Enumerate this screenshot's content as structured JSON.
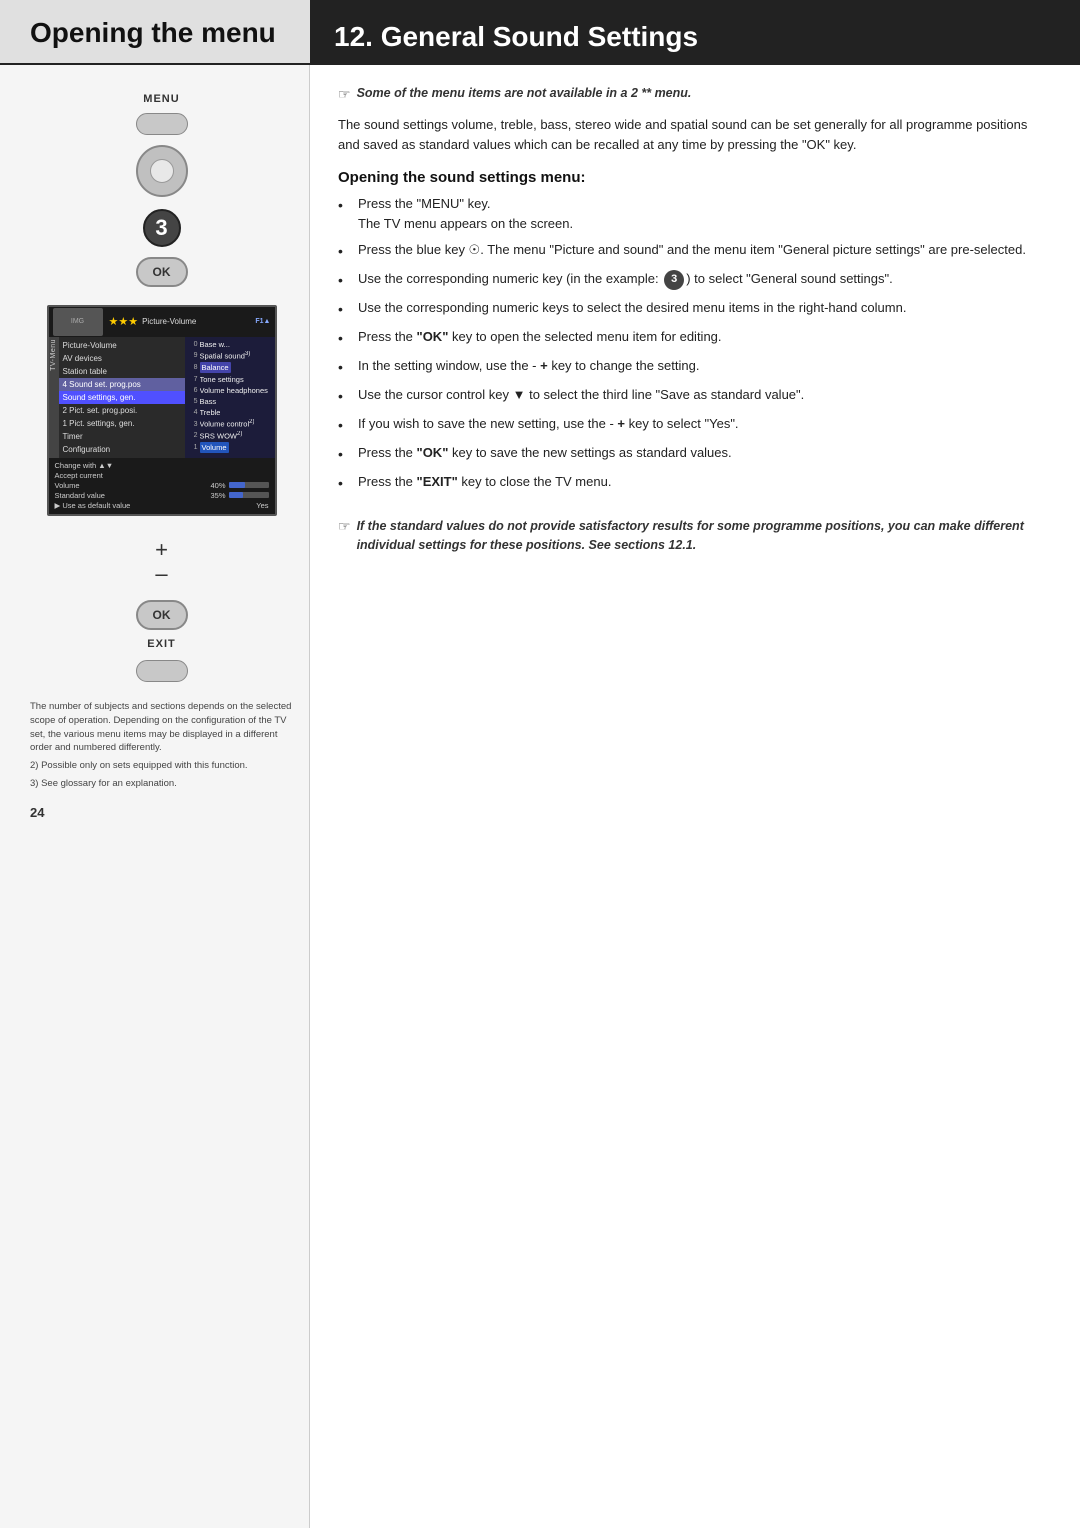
{
  "header": {
    "left_title": "Opening the menu",
    "right_title": "12. General Sound Settings"
  },
  "left_col": {
    "menu_label": "MENU",
    "number_3": "3",
    "ok_label": "OK",
    "ok_label2": "OK",
    "exit_label": "EXIT",
    "tv_menu": {
      "stars": "★★★",
      "prog_label": "Picture-Volume",
      "menu_items": [
        "AV devices",
        "Station table",
        "Timer",
        "Configuration"
      ],
      "selected_item": "Sound settings, gen.",
      "change_label": "Change with",
      "accept_label": "Accept current",
      "default_label": "value as default",
      "value_label": "value.",
      "right_items": [
        {
          "num": "0",
          "label": "Base w..."
        },
        {
          "num": "9",
          "label": "Spatial sound"
        },
        {
          "num": "8",
          "label": "Balance"
        },
        {
          "num": "7",
          "label": "Tone settings"
        },
        {
          "num": "6",
          "label": "Volume headphones"
        },
        {
          "num": "5",
          "label": "Bass"
        },
        {
          "num": "4",
          "label": "Treble"
        },
        {
          "num": "3",
          "label": "Volume control"
        },
        {
          "num": "2",
          "label": "SRS WOW"
        },
        {
          "num": "1",
          "label": "Volume"
        }
      ],
      "bottom_rows": [
        {
          "label": "Volume",
          "value": "40%",
          "bar_width": "40"
        },
        {
          "label": "Standard value",
          "value": "35%",
          "bar_width": "35"
        },
        {
          "label": "Use as default value",
          "value": "Yes",
          "bar_width": "0"
        }
      ]
    },
    "footnotes": [
      "The number of subjects and sections depends on the selected scope of operation. Depending on the configuration of the TV set, the various menu items may be displayed in a different order and numbered differently.",
      "2) Possible only on sets equipped with this function.",
      "3) See glossary for an explanation."
    ],
    "page_number": "24"
  },
  "right_col": {
    "note_text": "Some of the menu items are not available in a 2 ** menu.",
    "body_text": "The sound settings volume, treble, bass, stereo wide and spatial sound can be set generally for all programme positions and saved as standard values which can be recalled at any time by pressing the \"OK\" key.",
    "section_heading": "Opening the sound settings menu:",
    "bullets": [
      {
        "text": "Press the \"MENU\" key.\nThe TV menu appears on the screen."
      },
      {
        "text": "Press the blue key ☉. The menu \"Picture and sound\" and the menu item \"General picture settings\" are pre-selected."
      },
      {
        "text": "Use the corresponding numeric key (in the example: 3) to select \"General sound settings\"."
      },
      {
        "text": "Use the corresponding numeric keys to select the desired menu items in the right-hand column."
      },
      {
        "text": "Press the \"OK\" key to open the selected menu item for editing."
      },
      {
        "text": "In the setting window, use the - + key to change the setting."
      },
      {
        "text": "Use the cursor control key ▼ to select the third line \"Save as standard value\"."
      },
      {
        "text": "If you wish to save the new setting, use the - + key to select \"Yes\"."
      },
      {
        "text": "Press the \"OK\" key to save the new settings as standard values."
      },
      {
        "text": "Press the \"EXIT\" key to close the TV menu."
      }
    ],
    "italic_note": "If the standard values do not provide satisfactory results for some programme positions, you can make different individual settings for these positions. See sections 12.1."
  }
}
